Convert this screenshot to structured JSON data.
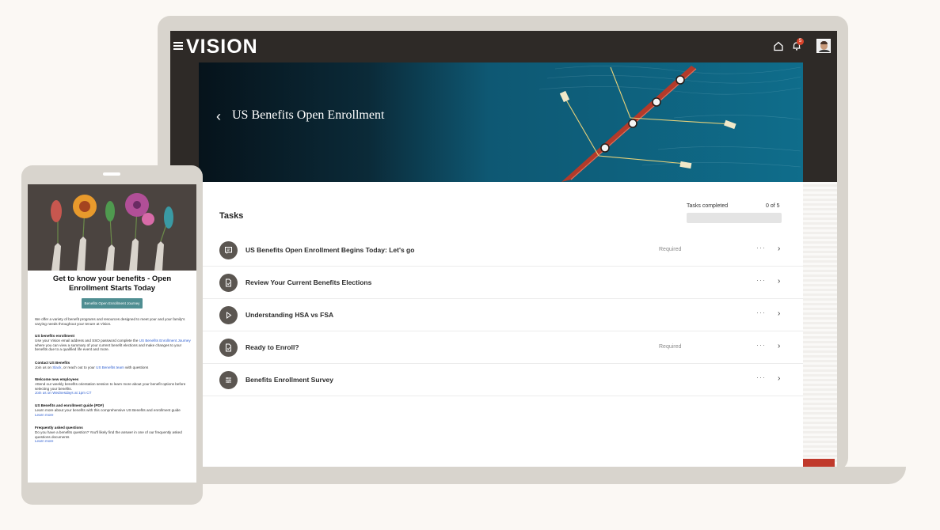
{
  "app": {
    "logo": "VISION",
    "notification_count": "5"
  },
  "banner": {
    "title": "US Benefits Open Enrollment"
  },
  "tasks": {
    "title": "Tasks",
    "progress_label": "Tasks completed",
    "progress_count": "0 of 5",
    "progress_fraction": 0,
    "items": [
      {
        "title": "US Benefits Open Enrollment Begins Today: Let's go",
        "status": "Required",
        "icon": "chat-icon"
      },
      {
        "title": "Review Your Current Benefits Elections",
        "status": "",
        "icon": "document-icon"
      },
      {
        "title": "Understanding HSA vs FSA",
        "status": "",
        "icon": "play-icon"
      },
      {
        "title": "Ready to Enroll?",
        "status": "Required",
        "icon": "document-icon"
      },
      {
        "title": "Benefits Enrollment Survey",
        "status": "",
        "icon": "survey-icon"
      }
    ],
    "more_glyph": "···",
    "chevron_glyph": "›"
  },
  "tablet": {
    "heading": "Get to know your benefits - Open Enrollment Starts Today",
    "button": "Benefits Open Enrollment Journey",
    "intro": "We offer a variety of benefit programs and resources designed to meet your and your family's varying needs throughout your tenure at Vision.",
    "sections": [
      {
        "title": "US benefits enrollment",
        "pre": "Use your Vision email address and SSO password complete the ",
        "link": "US Benefits Enrollment Journey",
        "post": " where you can view a summary of your current benefit elections and make changes to your benefits due to a qualified life event and more."
      },
      {
        "title": "Contact US Benefits",
        "pre": "Join us on ",
        "link": "Slack",
        "mid": ", or reach out to your ",
        "link2": "US Benefits team",
        "post": " with questions"
      },
      {
        "title": "Welcome new employees",
        "pre": "Attend our weekly benefits orientation session to learn more about your benefit options before selecting your benefits.",
        "link": "Join us on Wednesdays at 1pm CT",
        "post": ""
      },
      {
        "title": "US Benefits and enrollment guide (PDF)",
        "pre": "Learn more about your benefits with this comprehensive US Benefits and enrollment guide",
        "link": "Learn more",
        "post": ""
      },
      {
        "title": "Frequently asked questions",
        "pre": "Do you have a benefits question? You'll likely find the answer in one of our frequently asked questions documents",
        "link": "Learn more",
        "post": ""
      }
    ]
  },
  "colors": {
    "topbar": "#2e2a27",
    "banner_teal": "#0f6d8b",
    "icon_circle": "#5b5651",
    "button_teal": "#4f8e92",
    "accent_red": "#c0392b"
  }
}
